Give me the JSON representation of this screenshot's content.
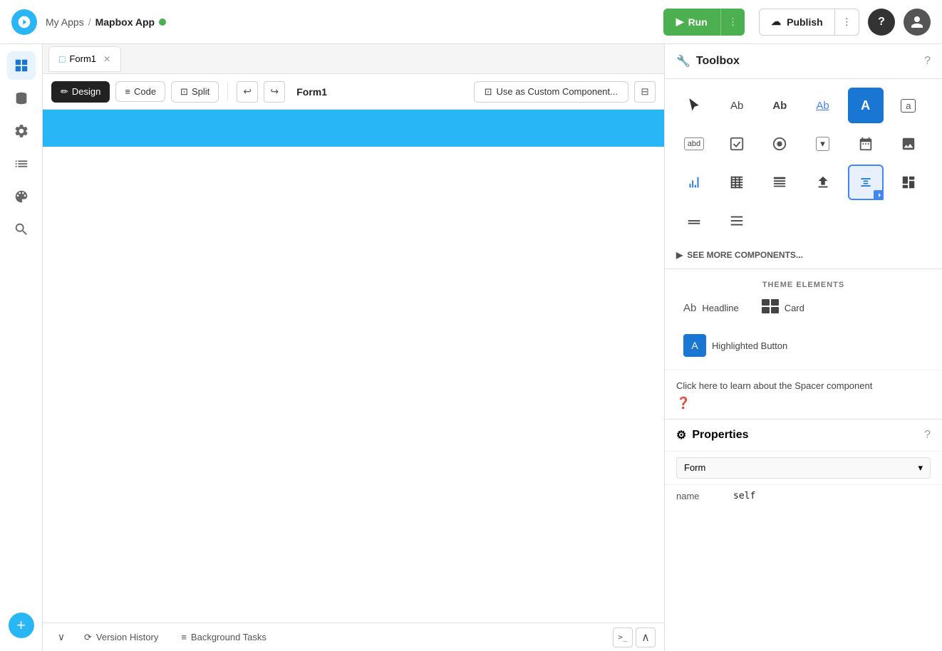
{
  "topnav": {
    "logo": "★",
    "breadcrumb": {
      "my_apps": "My Apps",
      "separator": "/",
      "app_name": "Mapbox App"
    },
    "run_label": "Run",
    "run_more_icon": "⋮",
    "publish_label": "Publish",
    "publish_icon": "☁",
    "publish_more_icon": "⋮",
    "help_label": "?",
    "user_label": "👤"
  },
  "sidebar": {
    "icons": [
      {
        "name": "pages-icon",
        "symbol": "⧉",
        "active": true
      },
      {
        "name": "database-icon",
        "symbol": "🗄",
        "active": false
      },
      {
        "name": "settings-icon",
        "symbol": "⚙",
        "active": false
      },
      {
        "name": "list-icon",
        "symbol": "☰",
        "active": false
      },
      {
        "name": "theme-icon",
        "symbol": "🎨",
        "active": false
      },
      {
        "name": "search-icon",
        "symbol": "🔍",
        "active": false
      }
    ],
    "add_icon": "+"
  },
  "tabs": [
    {
      "name": "Form1",
      "icon": "□",
      "closeable": true
    }
  ],
  "toolbar": {
    "design_label": "Design",
    "code_label": "Code",
    "split_label": "Split",
    "form_title": "Form1",
    "custom_component_label": "Use as Custom Component...",
    "layout_icon": "⊟"
  },
  "toolbox": {
    "title": "Toolbox",
    "help_icon": "?",
    "components": [
      {
        "id": "cursor",
        "label": "cursor"
      },
      {
        "id": "text-normal",
        "label": "text"
      },
      {
        "id": "text-bold",
        "label": "text-bold"
      },
      {
        "id": "text-link",
        "label": "text-link"
      },
      {
        "id": "button-filled",
        "label": "button-filled"
      },
      {
        "id": "button-outline",
        "label": "button-outline"
      },
      {
        "id": "input",
        "label": "input"
      },
      {
        "id": "checkbox",
        "label": "checkbox"
      },
      {
        "id": "radio",
        "label": "radio"
      },
      {
        "id": "select",
        "label": "select"
      },
      {
        "id": "calendar",
        "label": "calendar"
      },
      {
        "id": "image",
        "label": "image"
      },
      {
        "id": "chart",
        "label": "chart"
      },
      {
        "id": "table-grid",
        "label": "table-grid"
      },
      {
        "id": "table-list",
        "label": "table-list"
      },
      {
        "id": "upload",
        "label": "upload"
      },
      {
        "id": "spacer",
        "label": "spacer",
        "active": true
      },
      {
        "id": "dashboard",
        "label": "dashboard"
      }
    ],
    "row2_extra": [
      {
        "id": "footer1",
        "label": "footer1"
      },
      {
        "id": "footer2",
        "label": "footer2"
      }
    ],
    "see_more_label": "SEE MORE COMPONENTS...",
    "theme_label": "THEME ELEMENTS",
    "theme_items": [
      {
        "icon": "Ab",
        "label": "Headline"
      },
      {
        "icon": "⊟",
        "label": "Card"
      },
      {
        "icon": "A",
        "label": "Highlighted Button",
        "button": true
      }
    ],
    "info_text": "Click here to learn about the Spacer component"
  },
  "properties": {
    "title": "Properties",
    "help_icon": "?",
    "form_label": "Form",
    "form_dropdown_icon": "▾",
    "name_label": "name",
    "name_value": "self"
  },
  "bottom": {
    "version_history_label": "Version History",
    "background_tasks_label": "Background Tasks",
    "collapse_icon": "∧",
    "terminal_icon": ">_"
  }
}
